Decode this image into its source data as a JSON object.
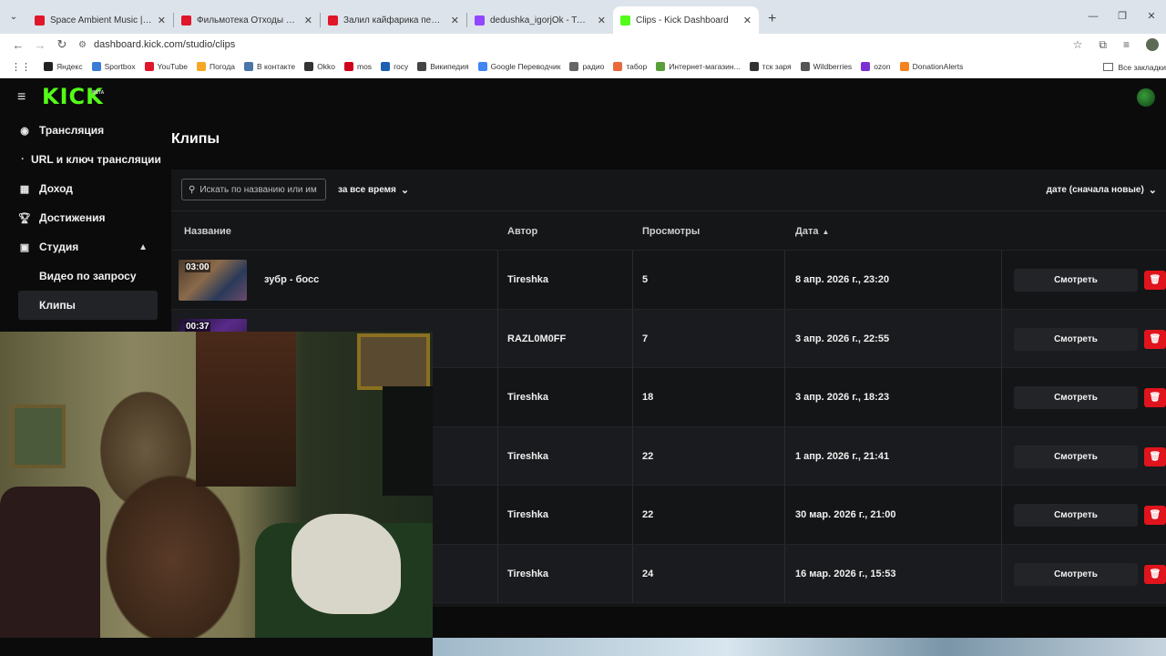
{
  "browser": {
    "tabs": [
      {
        "label": "Space Ambient Music | INTER",
        "color": "#e0162b"
      },
      {
        "label": "Фильмотека Отходы Общества",
        "color": "#e0162b"
      },
      {
        "label": "Залил кайфарика перцовкой",
        "color": "#e0162b"
      },
      {
        "label": "dedushka_igorjOk - Twitch",
        "color": "#9146ff"
      },
      {
        "label": "Clips - Kick Dashboard",
        "color": "#53fc18"
      }
    ],
    "url": "dashboard.kick.com/studio/clips",
    "bookmarks": [
      {
        "label": "Яндекс",
        "color": "#222222"
      },
      {
        "label": "Sportbox",
        "color": "#3a7bd5"
      },
      {
        "label": "YouTube",
        "color": "#e0162b"
      },
      {
        "label": "Погода",
        "color": "#f5a623"
      },
      {
        "label": "В контакте",
        "color": "#4a76a8"
      },
      {
        "label": "Okko",
        "color": "#333333"
      },
      {
        "label": "mos",
        "color": "#d0021b"
      },
      {
        "label": "госу",
        "color": "#1e5fb4"
      },
      {
        "label": "Википедия",
        "color": "#444444"
      },
      {
        "label": "Google Переводчик",
        "color": "#4285f4"
      },
      {
        "label": "радио",
        "color": "#666666"
      },
      {
        "label": "табор",
        "color": "#e86a3a"
      },
      {
        "label": "Интернет-магазин...",
        "color": "#5a9e3a"
      },
      {
        "label": "тск заря",
        "color": "#333333"
      },
      {
        "label": "Wildberries",
        "color": "#555555"
      },
      {
        "label": "ozon",
        "color": "#7b2fd0"
      },
      {
        "label": "DonationAlerts",
        "color": "#f58220"
      }
    ],
    "bookmarks_all": "Все закладки"
  },
  "kick": {
    "logo": "KICK",
    "beta": "BETA",
    "accent": "#53fc18"
  },
  "sidebar": {
    "items": [
      {
        "label": "Трансляция"
      },
      {
        "label": "URL и ключ трансляции"
      },
      {
        "label": "Доход"
      },
      {
        "label": "Достижения"
      },
      {
        "label": "Студия"
      },
      {
        "label": "Видео по запросу"
      },
      {
        "label": "Клипы"
      }
    ]
  },
  "page": {
    "title": "Клипы"
  },
  "filters": {
    "search_placeholder": "Искать по названию или им",
    "time_filter": "за все время",
    "sort": "дате (сначала новые)"
  },
  "table": {
    "headers": {
      "name": "Название",
      "author": "Автор",
      "views": "Просмотры",
      "date": "Дата"
    },
    "watch_label": "Смотреть",
    "rows": [
      {
        "duration": "03:00",
        "title": "зубр - босс",
        "author": "Tireshka",
        "views": "5",
        "date": "8 апр. 2026 г., 23:20"
      },
      {
        "duration": "00:37",
        "title": "",
        "author": "RAZL0M0FF",
        "views": "7",
        "date": "3 апр. 2026 г., 22:55"
      },
      {
        "duration": "",
        "title": "",
        "author": "Tireshka",
        "views": "18",
        "date": "3 апр. 2026 г., 18:23"
      },
      {
        "duration": "",
        "title": "",
        "author": "Tireshka",
        "views": "22",
        "date": "1 апр. 2026 г., 21:41"
      },
      {
        "duration": "",
        "title": "",
        "author": "Tireshka",
        "views": "22",
        "date": "30 мар. 2026 г., 21:00"
      },
      {
        "duration": "",
        "title": "",
        "author": "Tireshka",
        "views": "24",
        "date": "16 мар. 2026 г., 15:53"
      }
    ]
  }
}
